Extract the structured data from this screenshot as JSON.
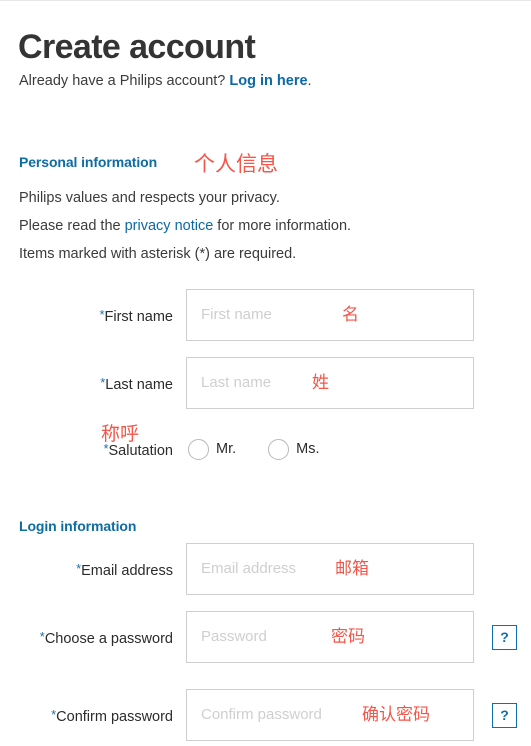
{
  "page": {
    "title": "Create account"
  },
  "login_prompt": {
    "text_before": "Already have a Philips account? ",
    "link_label": "Log in here",
    "text_after": "."
  },
  "personal_section": {
    "header": "Personal information",
    "header_annotation": "个人信息",
    "intro_1": "Philips values and respects your privacy.",
    "intro_2_before": "Please read the ",
    "intro_2_link": "privacy notice",
    "intro_2_after": " for more information.",
    "intro_3": "Items marked with asterisk (*) are required.",
    "fields": {
      "first_name": {
        "label": "First name",
        "required_mark": "*",
        "placeholder": "First name",
        "value": "",
        "annotation": "名"
      },
      "last_name": {
        "label": "Last name",
        "required_mark": "*",
        "placeholder": "Last name",
        "value": "",
        "annotation": "姓"
      },
      "salutation": {
        "label": "Salutation",
        "required_mark": "*",
        "annotation": "称呼",
        "options": [
          {
            "label": "Mr.",
            "selected": false
          },
          {
            "label": "Ms.",
            "selected": false
          }
        ]
      }
    }
  },
  "login_section": {
    "header": "Login information",
    "fields": {
      "email": {
        "label": "Email address",
        "required_mark": "*",
        "placeholder": "Email address",
        "value": "",
        "annotation": "邮箱"
      },
      "password": {
        "label": "Choose a password",
        "required_mark": "*",
        "placeholder": "Password",
        "value": "",
        "annotation": "密码",
        "help_label": "?"
      },
      "confirm_password": {
        "label": "Confirm password",
        "required_mark": "*",
        "placeholder": "Confirm password",
        "value": "",
        "annotation": "确认密码",
        "help_label": "?"
      }
    }
  },
  "colors": {
    "brand_blue": "#0d6ca3",
    "link_blue": "#0d69a5",
    "annotation_red": "#f4564a",
    "title_gray": "#343434",
    "field_border": "#cfcfcf",
    "placeholder_gray": "#cfcfcf"
  }
}
